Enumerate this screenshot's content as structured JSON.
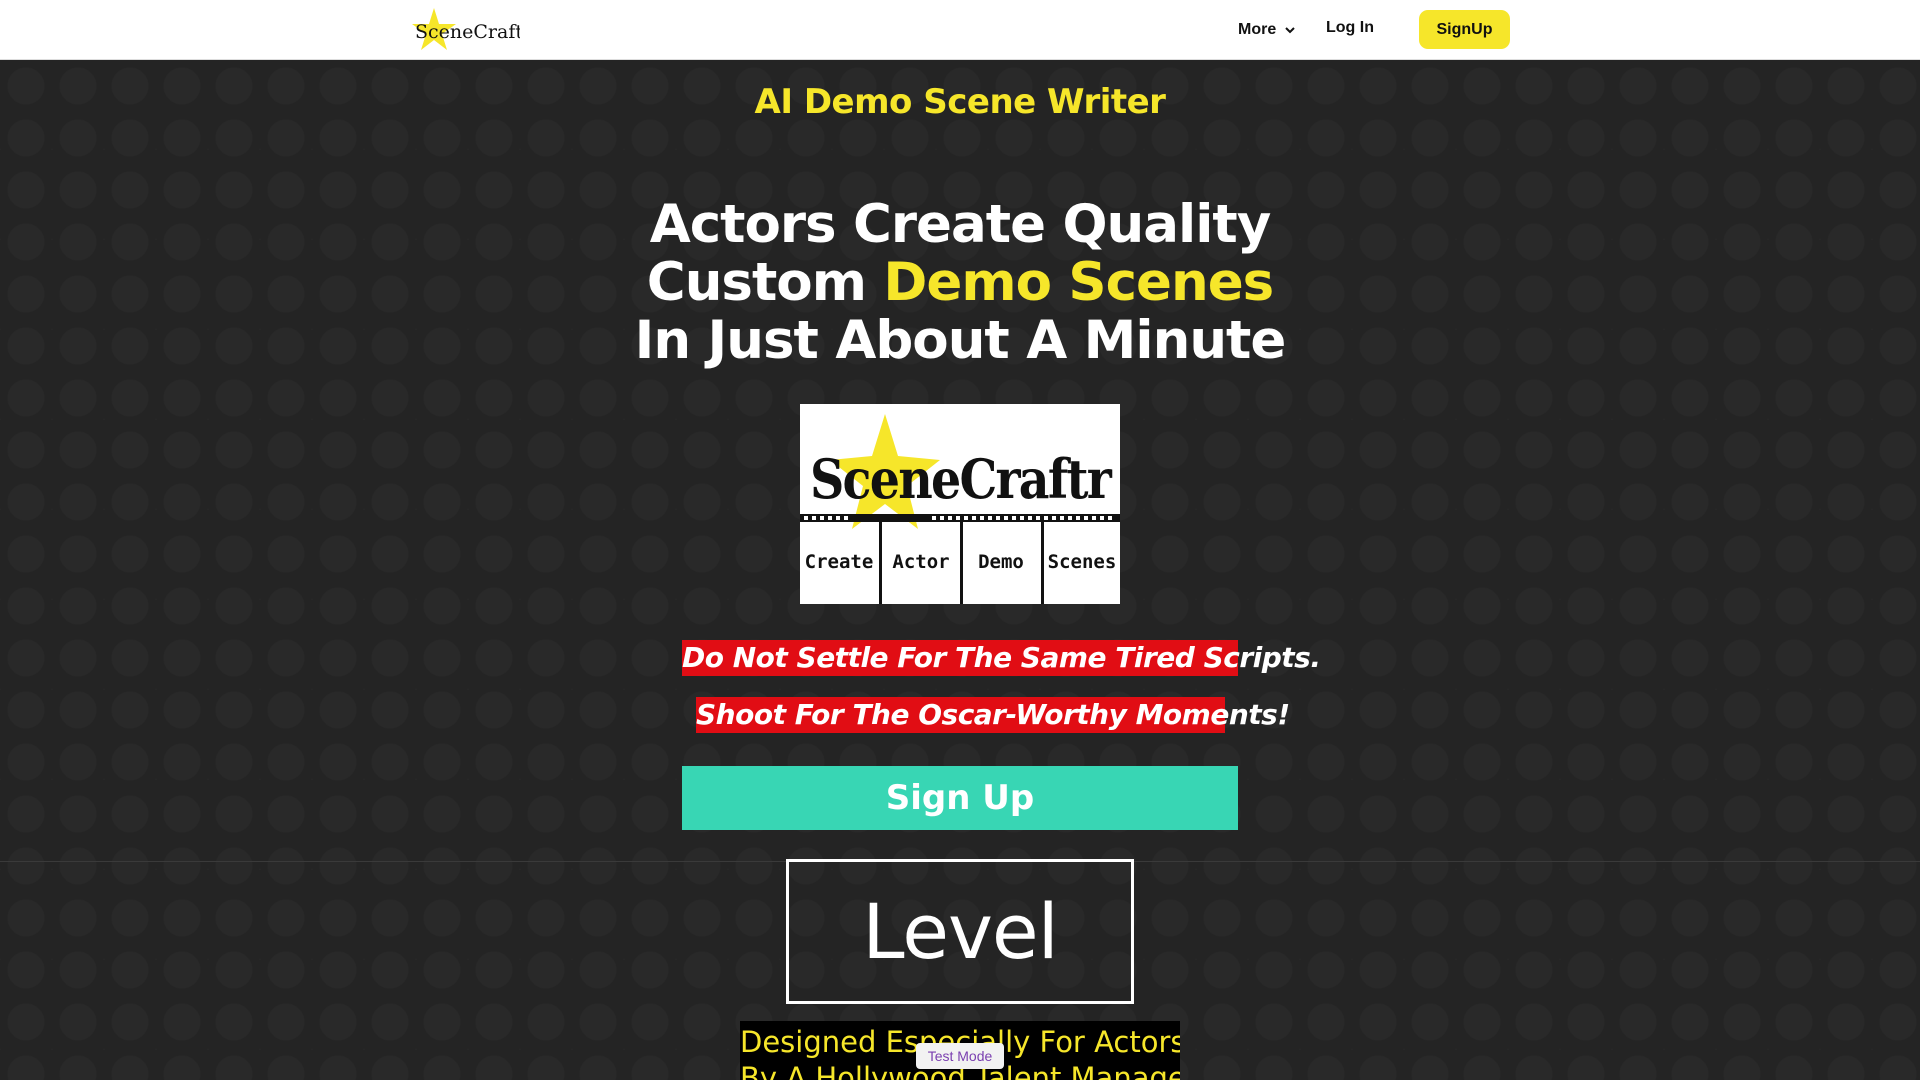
{
  "nav": {
    "logo_text": "SceneCraftr",
    "more_label": "More",
    "login_label": "Log In",
    "signup_label": "SignUp"
  },
  "hero": {
    "subtitle": "AI Demo Scene Writer",
    "headline_line1": "Actors Create Quality",
    "headline_line2_a": "Custom ",
    "headline_line2_b": "Demo Scenes",
    "headline_line3": "In Just About A Minute",
    "logo_card": {
      "title": "SceneCraftr",
      "cells": [
        "Create",
        "Actor",
        "Demo",
        "Scenes"
      ]
    },
    "tagline1": "Do Not Settle For The Same Tired Scripts.",
    "tagline2": "Shoot For The Oscar-Worthy Moments!",
    "cta_label": "Sign Up"
  },
  "section2": {
    "heading": "Level Up!",
    "line1": "Designed Especially For Actors",
    "line2": "By A Hollywood Talent Manager"
  },
  "badge": {
    "test_mode": "Test Mode"
  },
  "colors": {
    "accent_yellow": "#f6e62a",
    "tag_red": "#e10d14",
    "cta_teal": "#38d6b4",
    "background": "#242424"
  }
}
